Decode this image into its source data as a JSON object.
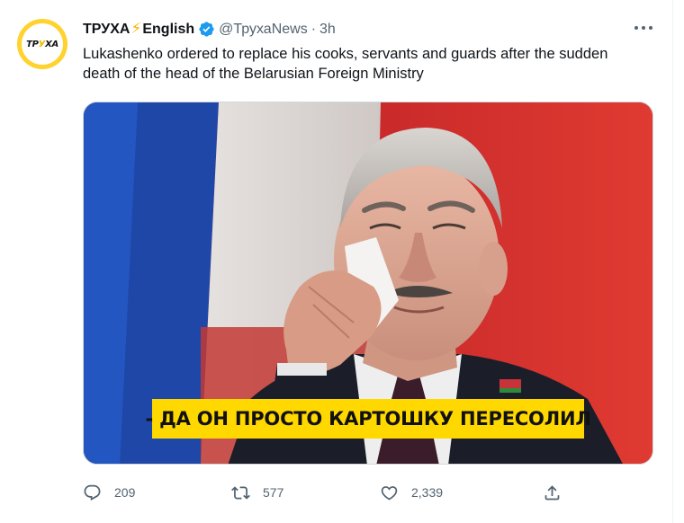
{
  "account": {
    "display_name": "ТРУХА",
    "display_suffix": "English",
    "bolt": "⚡",
    "handle": "@ТрухаNews",
    "separator": "·",
    "time": "3h",
    "avatar_text_pre": "ТР",
    "avatar_text_y": "У",
    "avatar_text_post": "ХА"
  },
  "tweet": {
    "text": "Lukashenko ordered to replace his cooks, servants and guards after the sudden death of the head of the Belarusian Foreign Ministry"
  },
  "media": {
    "caption": "- ДА ОН ПРОСТО КАРТОШКУ ПЕРЕСОЛИЛ"
  },
  "actions": {
    "reply_count": "209",
    "retweet_count": "577",
    "like_count": "2,339"
  },
  "colors": {
    "accent": "#1d9bf0",
    "caption_bg": "#ffd800",
    "muted": "#536471"
  },
  "icons": [
    "verified-badge-icon",
    "more-icon",
    "reply-icon",
    "retweet-icon",
    "like-icon",
    "share-icon"
  ]
}
